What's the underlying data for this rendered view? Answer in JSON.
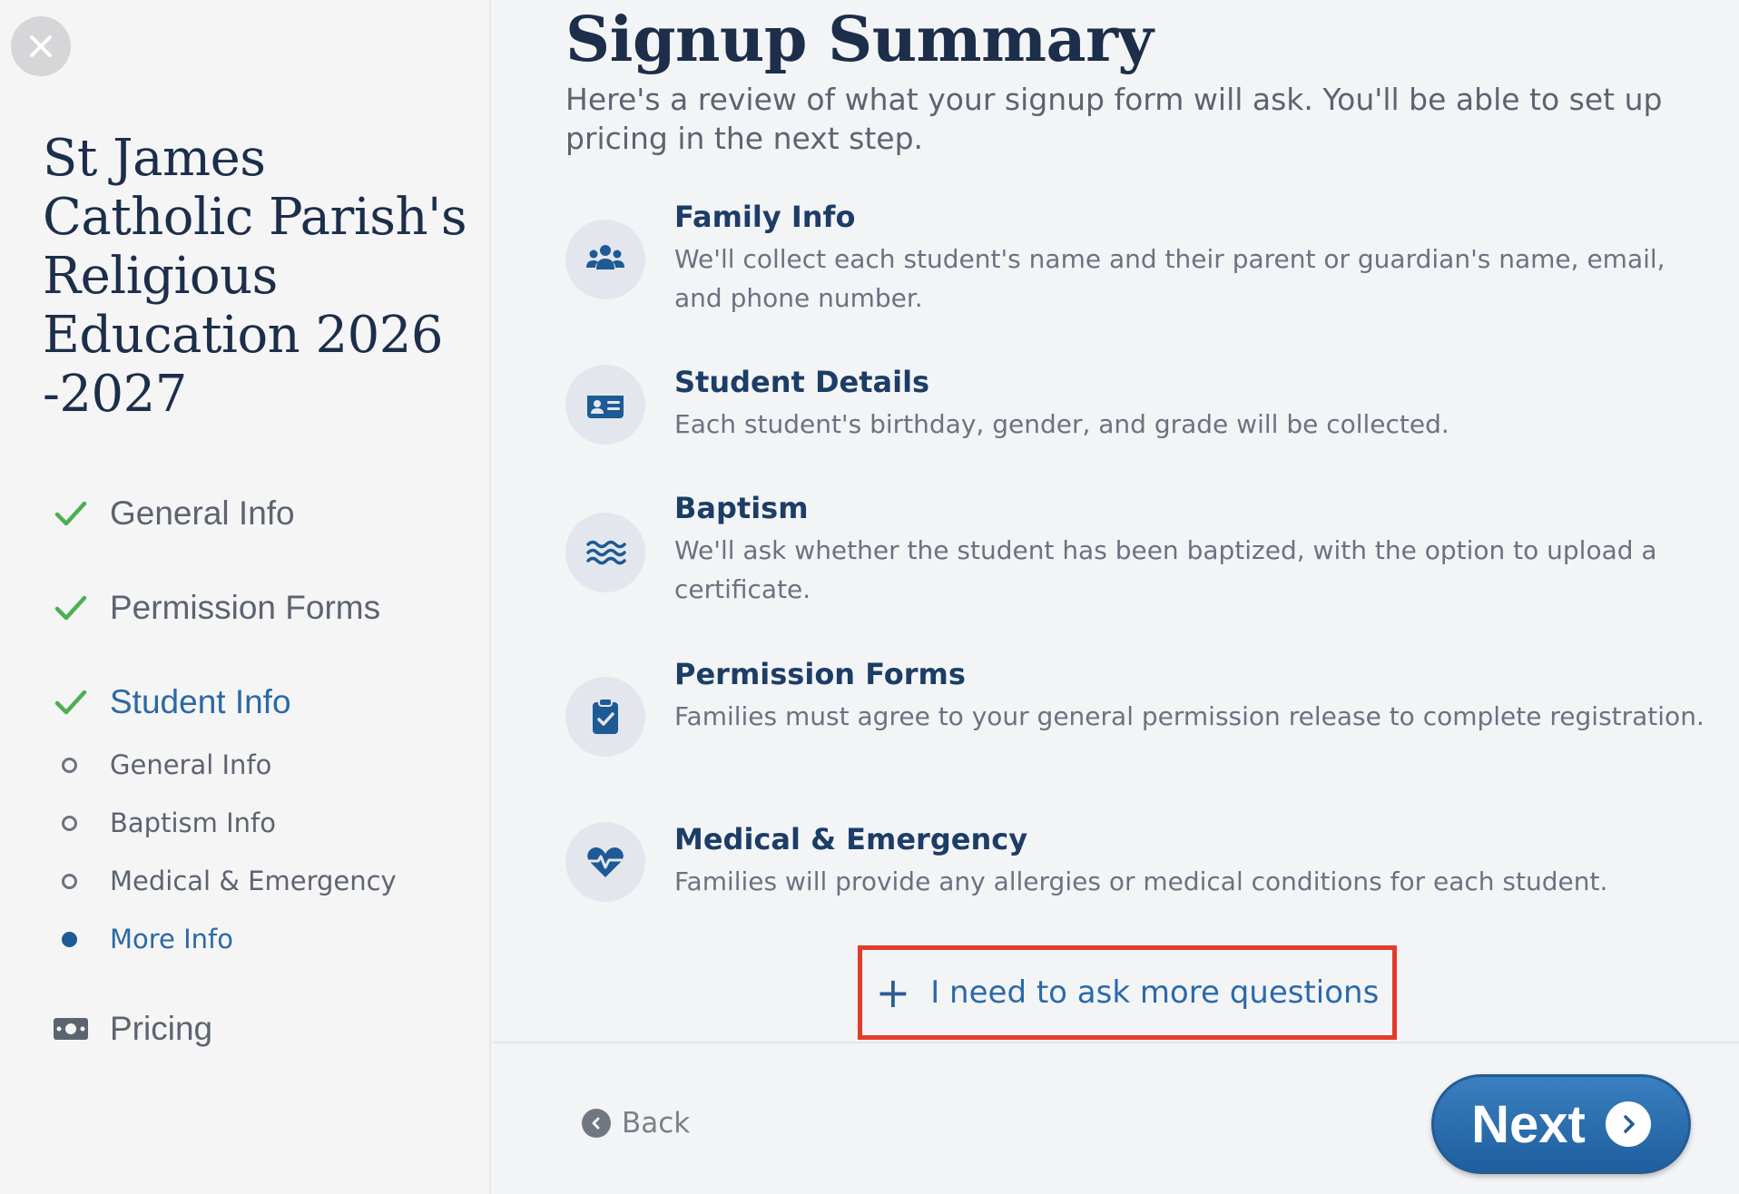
{
  "sidebar": {
    "close_icon": "close-icon",
    "org_title": "St James Catholic Parish's Religious Education 2026 -2027",
    "steps": [
      {
        "label": "General Info",
        "icon": "check-icon",
        "state": "done"
      },
      {
        "label": "Permission Forms",
        "icon": "check-icon",
        "state": "done"
      },
      {
        "label": "Student Info",
        "icon": "check-icon",
        "state": "active"
      }
    ],
    "substeps": [
      {
        "label": "General Info",
        "icon": "circle-outline-icon"
      },
      {
        "label": "Baptism Info",
        "icon": "circle-outline-icon"
      },
      {
        "label": "Medical & Emergency",
        "icon": "circle-outline-icon"
      },
      {
        "label": "More Info",
        "icon": "circle-filled-icon",
        "state": "active"
      }
    ],
    "pricing": {
      "label": "Pricing",
      "icon": "money-icon"
    }
  },
  "main": {
    "title": "Signup Summary",
    "subtitle": "Here's a review of what your signup form will ask. You'll be able to set up pricing in the next step.",
    "items": [
      {
        "heading": "Family Info",
        "description": "We'll collect each student's name and their parent or guardian's name, email, and phone number.",
        "icon": "users-icon"
      },
      {
        "heading": "Student Details",
        "description": "Each student's birthday, gender, and grade will be collected.",
        "icon": "id-card-icon"
      },
      {
        "heading": "Baptism",
        "description": "We'll ask whether the student has been baptized, with the option to upload a certificate.",
        "icon": "water-icon"
      },
      {
        "heading": "Permission Forms",
        "description": "Families must agree to your general permission release to complete registration.",
        "icon": "clipboard-check-icon"
      },
      {
        "heading": "Medical & Emergency",
        "description": "Families will provide any allergies or medical conditions for each student.",
        "icon": "heart-pulse-icon"
      }
    ],
    "ask_more": {
      "plus": "+",
      "label": "I need to ask more questions"
    }
  },
  "footer": {
    "back_label": "Back",
    "next_label": "Next"
  },
  "colors": {
    "accent": "#2b69a3",
    "check": "#4caf50",
    "highlight": "#e23c2a",
    "title": "#1c2e4a"
  }
}
